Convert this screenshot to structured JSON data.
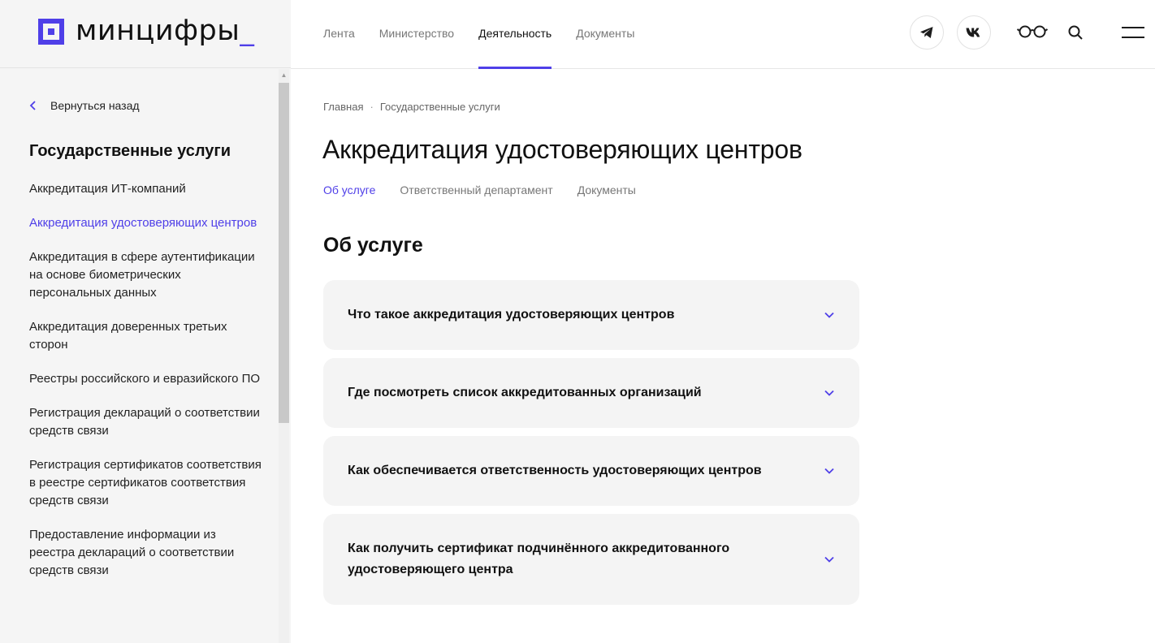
{
  "logo": {
    "text": "минцифры",
    "cursor": "_",
    "color": "#4f3fe8"
  },
  "sidebar": {
    "back_label": "Вернуться назад",
    "title": "Государственные услуги",
    "items": [
      {
        "label": "Аккредитация ИТ-компаний",
        "active": false
      },
      {
        "label": "Аккредитация удостоверяющих центров",
        "active": true
      },
      {
        "label": "Аккредитация в сфере аутентификации на основе биометрических персональных данных",
        "active": false
      },
      {
        "label": "Аккредитация доверенных третьих сторон",
        "active": false
      },
      {
        "label": "Реестры российского и евразийского ПО",
        "active": false
      },
      {
        "label": "Регистрация деклараций о соответствии средств связи",
        "active": false
      },
      {
        "label": "Регистрация сертификатов соответствия в реестре сертификатов соответствия средств связи",
        "active": false
      },
      {
        "label": "Предоставление информации из реестра деклараций о соответствии средств связи",
        "active": false
      }
    ]
  },
  "nav": {
    "items": [
      {
        "label": "Лента",
        "active": false
      },
      {
        "label": "Министерство",
        "active": false
      },
      {
        "label": "Деятельность",
        "active": true
      },
      {
        "label": "Документы",
        "active": false
      }
    ]
  },
  "header_icons": [
    "telegram-icon",
    "vk-icon",
    "glasses-icon",
    "search-icon",
    "menu-icon"
  ],
  "breadcrumb": {
    "home": "Главная",
    "separator": "·",
    "current": "Государственные услуги"
  },
  "page": {
    "title": "Аккредитация удостоверяющих центров",
    "tabs": [
      {
        "label": "Об услуге",
        "active": true
      },
      {
        "label": "Ответственный департамент",
        "active": false
      },
      {
        "label": "Документы",
        "active": false
      }
    ],
    "section_title": "Об услуге",
    "accordion": [
      {
        "title": "Что такое аккредитация удостоверяющих центров"
      },
      {
        "title": "Где посмотреть список аккредитованных организаций"
      },
      {
        "title": "Как обеспечивается ответственность удостоверяющих центров"
      },
      {
        "title": "Как получить сертификат подчинённого аккредитованного удостоверяющего центра"
      }
    ]
  },
  "colors": {
    "accent": "#4f3fe8",
    "sidebar_bg": "#f5f5f5",
    "card_bg": "#f4f4f4"
  }
}
